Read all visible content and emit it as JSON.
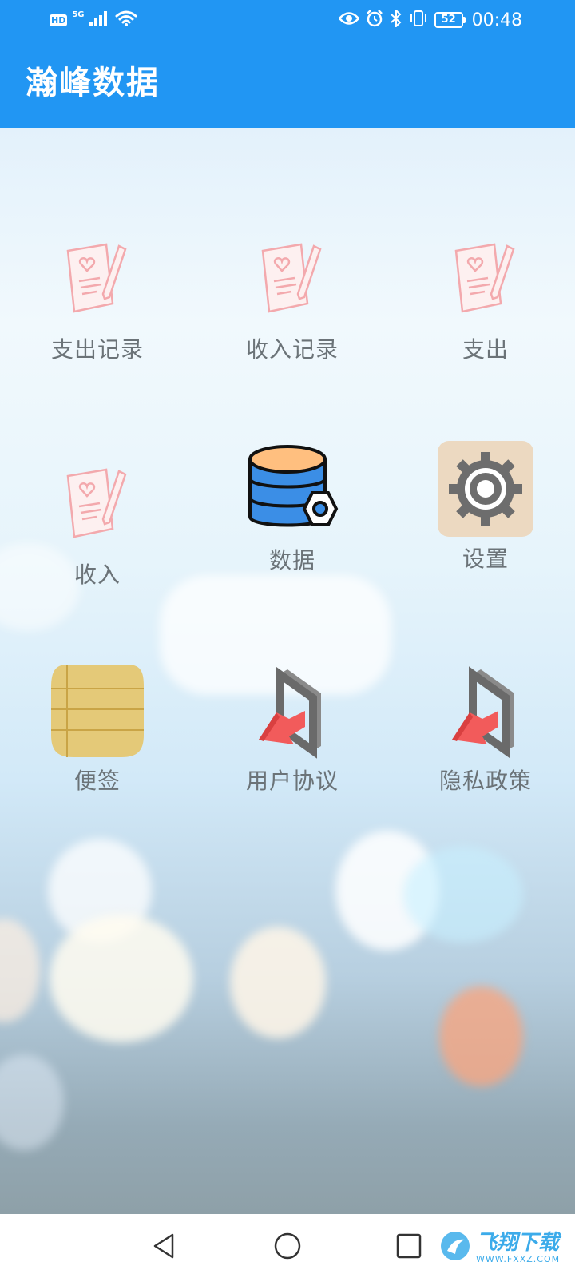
{
  "status_bar": {
    "hd": "HD",
    "network": "5G",
    "battery": "52",
    "time": "00:48",
    "icons": [
      "signal-icon",
      "wifi-icon",
      "eye-icon",
      "alarm-icon",
      "bluetooth-icon",
      "vibrate-icon",
      "battery-icon"
    ]
  },
  "app_bar": {
    "title": "瀚峰数据"
  },
  "grid": {
    "items": [
      {
        "label": "支出记录",
        "icon": "memo-icon"
      },
      {
        "label": "收入记录",
        "icon": "memo-icon"
      },
      {
        "label": "支出",
        "icon": "memo-icon"
      },
      {
        "label": "收入",
        "icon": "memo-icon"
      },
      {
        "label": "数据",
        "icon": "database-icon"
      },
      {
        "label": "设置",
        "icon": "gear-icon"
      },
      {
        "label": "便签",
        "icon": "notepad-icon"
      },
      {
        "label": "用户协议",
        "icon": "exit-arrow-icon"
      },
      {
        "label": "隐私政策",
        "icon": "exit-arrow-icon"
      }
    ]
  },
  "nav_bar": {
    "buttons": [
      "back-icon",
      "home-icon",
      "recents-icon"
    ]
  },
  "watermark": {
    "text": "飞翔下载",
    "sub": "WWW.FXXZ.COM"
  },
  "colors": {
    "app_bar": "#2196f3",
    "label": "#6b7378",
    "database_top": "#ffbf7f",
    "database_body": "#3b8ee6",
    "gear_bg": "#ecd9c1",
    "gear": "#6d6d6d",
    "notepad": "#e4c978",
    "arrow": "#f25b5b",
    "memo": "#f3a9ad"
  }
}
